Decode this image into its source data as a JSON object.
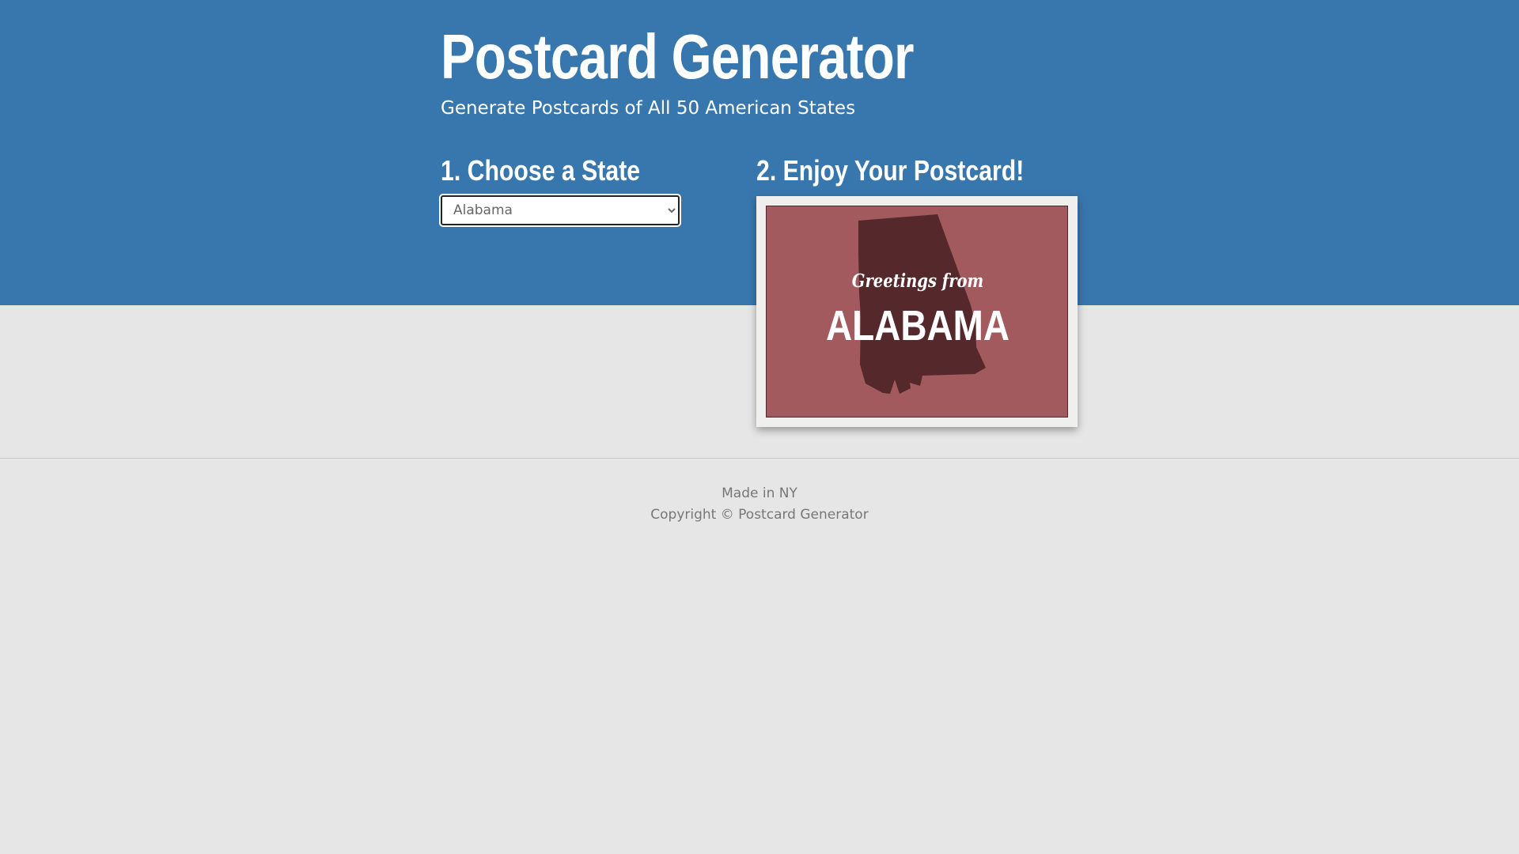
{
  "header": {
    "title": "Postcard Generator",
    "subtitle": "Generate Postcards of All 50 American States"
  },
  "steps": {
    "choose_label": "1. Choose a State",
    "enjoy_label": "2. Enjoy Your Postcard!"
  },
  "state_select": {
    "selected": "Alabama",
    "options": [
      "Alabama"
    ]
  },
  "postcard": {
    "greeting": "Greetings from",
    "state_name": "ALABAMA",
    "background_color": "#a25a5e",
    "shape_color": "#55282b"
  },
  "footer": {
    "made_in": "Made in NY",
    "copyright": "Copyright © Postcard Generator"
  },
  "colors": {
    "header_bg": "#3877ae",
    "page_bg": "#e6e6e6"
  }
}
